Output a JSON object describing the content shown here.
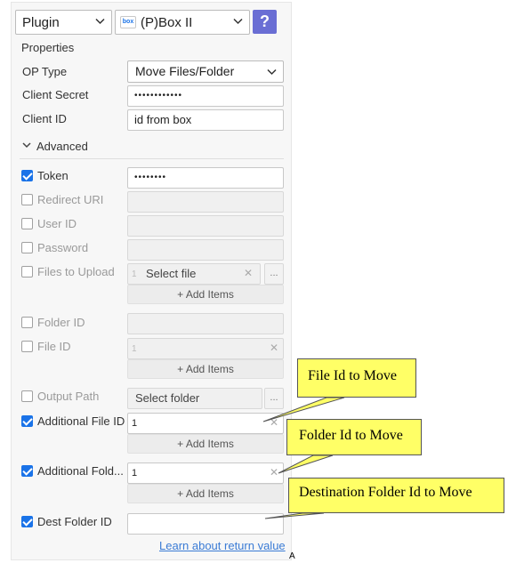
{
  "header": {
    "category_select": "Plugin",
    "plugin_select": "(P)Box II",
    "box_logo": "box",
    "help_label": "?"
  },
  "properties": {
    "section_label": "Properties",
    "op_type": {
      "label": "OP Type",
      "value": "Move Files/Folder"
    },
    "client_secret": {
      "label": "Client Secret",
      "value": "••••••••••••"
    },
    "client_id": {
      "label": "Client ID",
      "value": "id from box"
    }
  },
  "advanced": {
    "section_label": "Advanced",
    "token": {
      "label": "Token",
      "checked": true,
      "value": "••••••••"
    },
    "redirect_uri": {
      "label": "Redirect URI",
      "checked": false
    },
    "user_id": {
      "label": "User ID",
      "checked": false
    },
    "password": {
      "label": "Password",
      "checked": false
    },
    "files_to_upload": {
      "label": "Files to Upload",
      "checked": false,
      "index": "1",
      "value": "Select file",
      "dots": "...",
      "add_label": "Add Items"
    },
    "folder_id": {
      "label": "Folder ID",
      "checked": false
    },
    "file_id": {
      "label": "File ID",
      "checked": false,
      "index": "1",
      "add_label": "Add Items"
    },
    "output_path": {
      "label": "Output Path",
      "checked": false,
      "value": "Select folder",
      "dots": "..."
    },
    "additional_file_id": {
      "label": "Additional File ID",
      "checked": true,
      "value": "1",
      "add_label": "Add Items"
    },
    "additional_folder_id": {
      "label": "Additional Fold...",
      "checked": true,
      "value": "1",
      "add_label": "Add Items"
    },
    "dest_folder_id": {
      "label": "Dest Folder ID",
      "checked": true,
      "value": ""
    }
  },
  "footer": {
    "link": "Learn about return value",
    "mark": "A"
  },
  "callouts": {
    "file_id_to_move": "File Id to Move",
    "folder_id_to_move": "Folder Id to Move",
    "destination_folder_id": "Destination Folder Id to Move"
  },
  "colors": {
    "accent": "#1a73e8",
    "help_button": "#6a6ed4",
    "callout_fill": "#ffff66",
    "link": "#3a7bd5"
  }
}
